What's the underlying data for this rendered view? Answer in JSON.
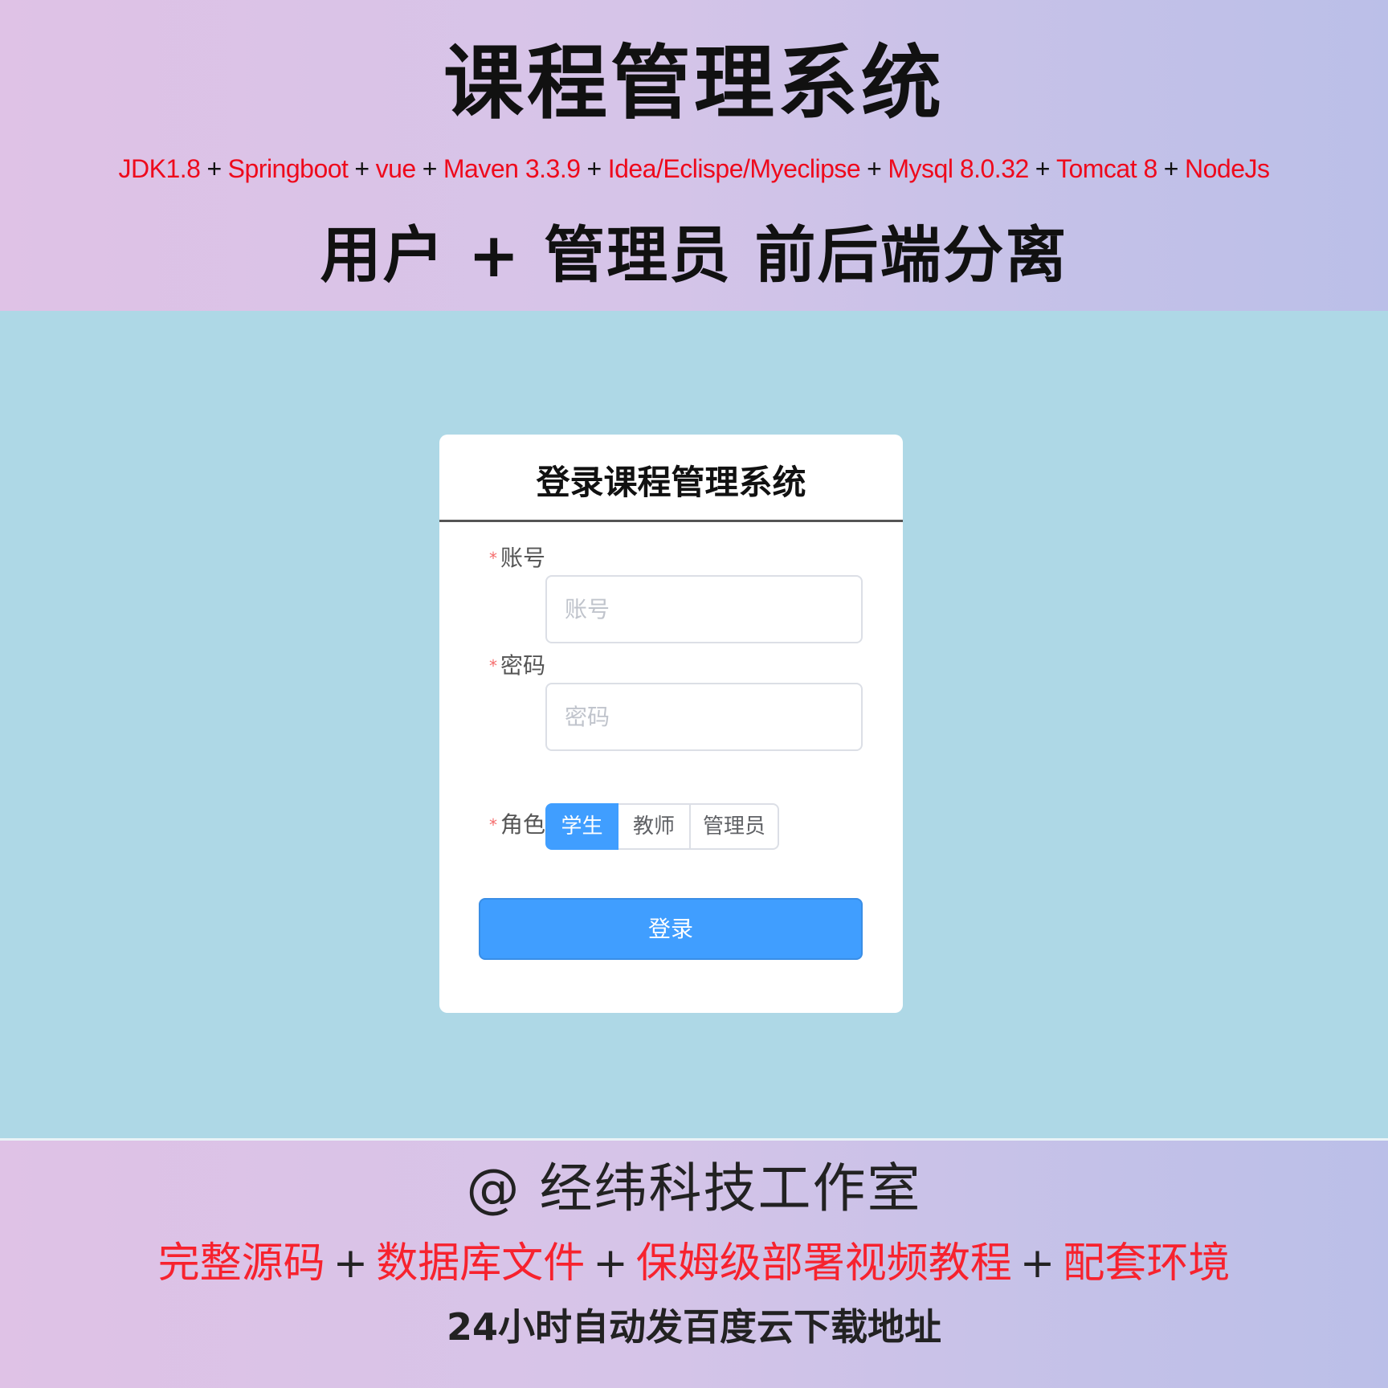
{
  "banner": {
    "title": "课程管理系统",
    "tech_stack": [
      "JDK1.8",
      "Springboot",
      "vue",
      "Maven 3.3.9",
      "Idea/Eclispe/Myeclipse",
      "Mysql 8.0.32",
      "Tomcat 8",
      "NodeJs"
    ],
    "separator": "+",
    "subtitle": "用户 + 管理员 前后端分离"
  },
  "login": {
    "title": "登录课程管理系统",
    "required_mark": "*",
    "account": {
      "label": "账号",
      "placeholder": "账号",
      "value": ""
    },
    "password": {
      "label": "密码",
      "placeholder": "密码",
      "value": ""
    },
    "role": {
      "label": "角色",
      "options": [
        "学生",
        "教师",
        "管理员"
      ],
      "selected": "学生"
    },
    "submit_label": "登录"
  },
  "footer": {
    "studio": "@ 经纬科技工作室",
    "features": [
      "完整源码",
      "数据库文件",
      "保姆级部署视频教程",
      "配套环境"
    ],
    "separator": "+",
    "delivery": "24小时自动发百度云下载地址"
  },
  "colors": {
    "accent_red": "#ee0a1c",
    "primary_blue": "#409eff",
    "mid_background": "#aed8e6"
  }
}
